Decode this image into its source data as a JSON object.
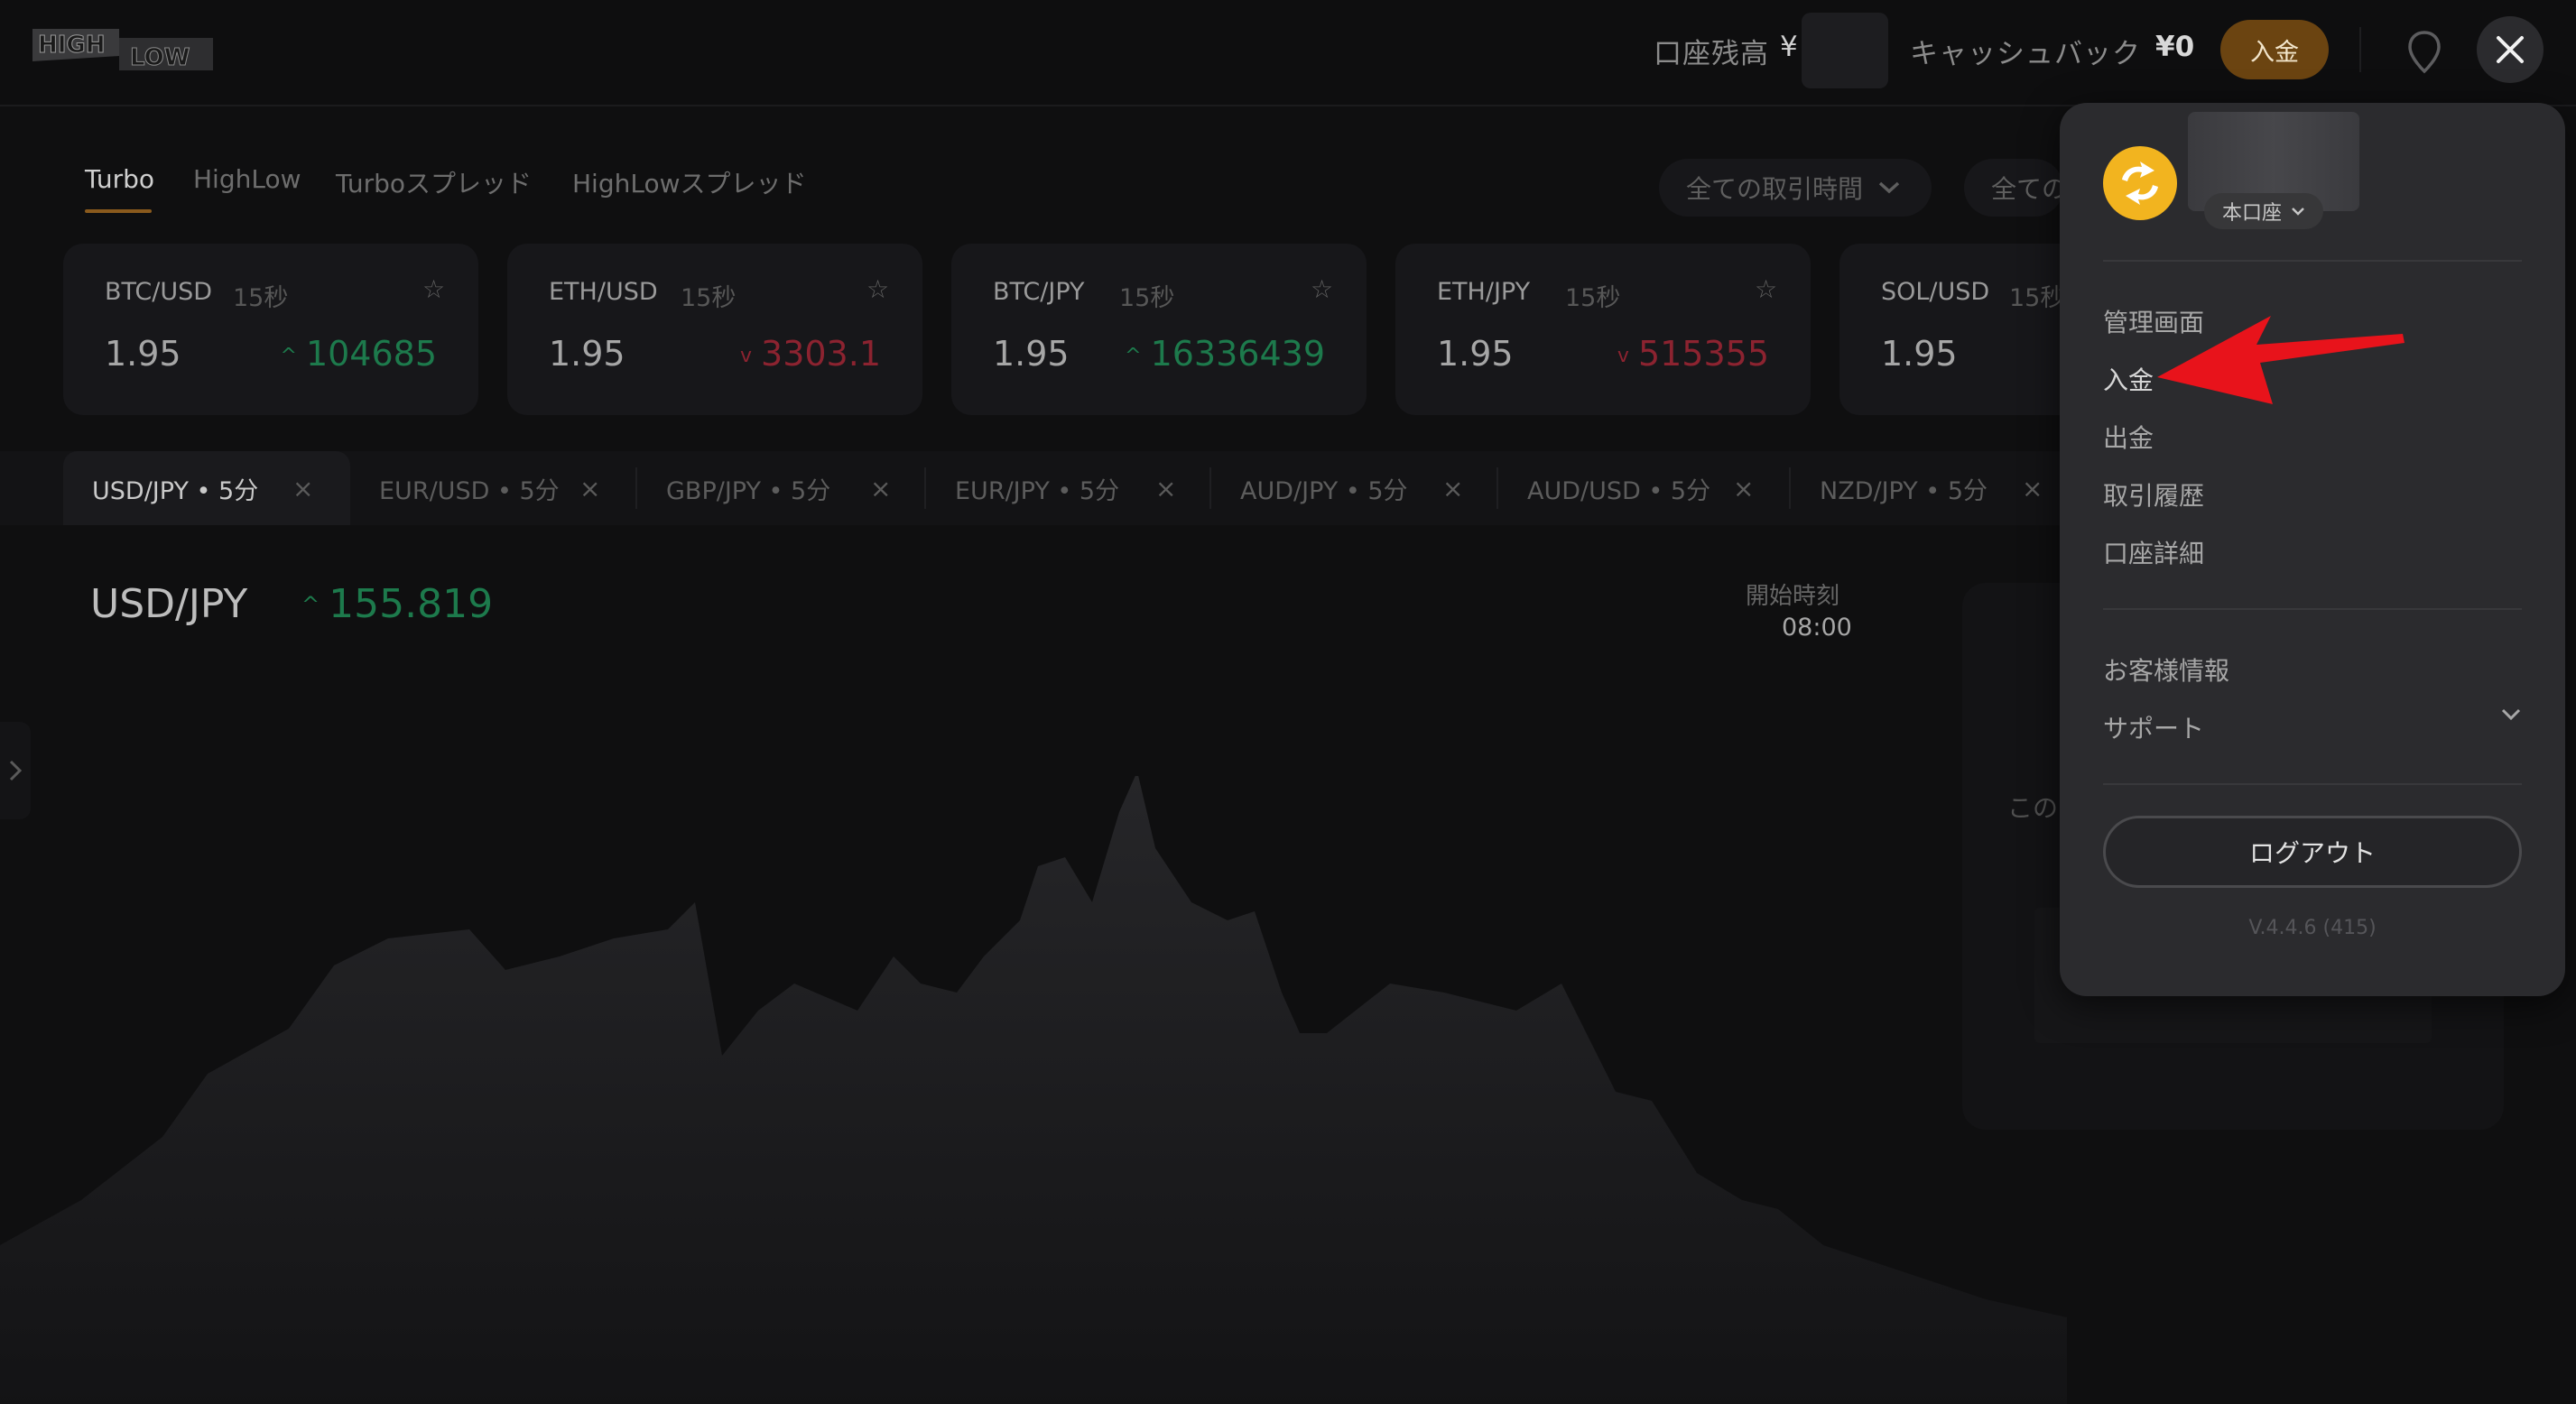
{
  "header": {
    "logo_top": "HIGH",
    "logo_bottom": "LOW",
    "balance_label": "口座残高",
    "balance_currency": "¥",
    "cashback_label": "キャッシュバック",
    "cashback_value": "¥0",
    "deposit_button": "入金",
    "location_icon": "location-pin-icon",
    "close_icon": "close-icon"
  },
  "product_tabs": [
    {
      "label": "Turbo",
      "active": true
    },
    {
      "label": "HighLow",
      "active": false
    },
    {
      "label": "Turboスプレッド",
      "active": false
    },
    {
      "label": "HighLowスプレッド",
      "active": false
    }
  ],
  "filters": {
    "trading_time": "全ての取引時間",
    "all_partial": "全ての"
  },
  "asset_cards": [
    {
      "pair": "BTC/USD",
      "duration": "15秒",
      "payout": "1.95",
      "price": "104685",
      "direction": "up"
    },
    {
      "pair": "ETH/USD",
      "duration": "15秒",
      "payout": "1.95",
      "price": "3303.1",
      "direction": "down"
    },
    {
      "pair": "BTC/JPY",
      "duration": "15秒",
      "payout": "1.95",
      "price": "16336439",
      "direction": "up"
    },
    {
      "pair": "ETH/JPY",
      "duration": "15秒",
      "payout": "1.95",
      "price": "515355",
      "direction": "down"
    },
    {
      "pair": "SOL/USD",
      "duration": "15秒",
      "payout": "1.95",
      "price": "",
      "direction": "up"
    }
  ],
  "instrument_tabs": [
    {
      "label": "USD/JPY • 5分",
      "active": true
    },
    {
      "label": "EUR/USD • 5分",
      "active": false
    },
    {
      "label": "GBP/JPY • 5分",
      "active": false
    },
    {
      "label": "EUR/JPY • 5分",
      "active": false
    },
    {
      "label": "AUD/JPY • 5分",
      "active": false
    },
    {
      "label": "AUD/USD • 5分",
      "active": false
    },
    {
      "label": "NZD/JPY • 5分",
      "active": false
    }
  ],
  "chart": {
    "pair": "USD/JPY",
    "price": "155.819",
    "direction": "up",
    "start_label": "開始時刻",
    "start_time": "08:00",
    "panel_text_partial": "この"
  },
  "menu": {
    "account_type": "本口座",
    "items_group1": [
      "管理画面",
      "入金",
      "出金",
      "取引履歴",
      "口座詳細"
    ],
    "items_group2": [
      "お客様情報",
      "サポート"
    ],
    "logout": "ログアウト",
    "version": "V.4.4.6 (415)"
  },
  "colors": {
    "up": "#1d7a4c",
    "down": "#8c2330",
    "accent": "#6b4411",
    "annotation_arrow": "#e8131b"
  }
}
